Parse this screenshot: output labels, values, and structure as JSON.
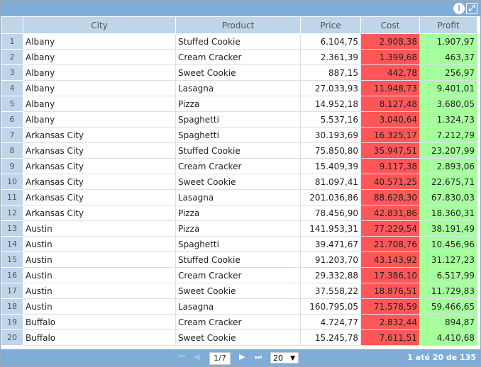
{
  "toolbar": {
    "info_icon": "i",
    "expand_icon": "⤢"
  },
  "columns": [
    "City",
    "Product",
    "Price",
    "Cost",
    "Profit"
  ],
  "rows": [
    [
      "1",
      "Albany",
      "Stuffed Cookie",
      "6.104,75",
      "2.908,38",
      "1.907,97"
    ],
    [
      "2",
      "Albany",
      "Cream Cracker",
      "2.361,39",
      "1.399,68",
      "463,37"
    ],
    [
      "3",
      "Albany",
      "Sweet Cookie",
      "887,15",
      "442,78",
      "256,97"
    ],
    [
      "4",
      "Albany",
      "Lasagna",
      "27.033,93",
      "11.948,73",
      "9.401,01"
    ],
    [
      "5",
      "Albany",
      "Pizza",
      "14.952,18",
      "8.127,48",
      "3.680,05"
    ],
    [
      "6",
      "Albany",
      "Spaghetti",
      "5.537,16",
      "3.040,64",
      "1.324,73"
    ],
    [
      "7",
      "Arkansas City",
      "Spaghetti",
      "30.193,69",
      "16.325,17",
      "7.212,79"
    ],
    [
      "8",
      "Arkansas City",
      "Stuffed Cookie",
      "75.850,80",
      "35.947,51",
      "23.207,99"
    ],
    [
      "9",
      "Arkansas City",
      "Cream Cracker",
      "15.409,39",
      "9.117,38",
      "2.893,06"
    ],
    [
      "10",
      "Arkansas City",
      "Sweet Cookie",
      "81.097,41",
      "40.571,25",
      "22.675,71"
    ],
    [
      "11",
      "Arkansas City",
      "Lasagna",
      "201.036,86",
      "88.628,30",
      "67.830,03"
    ],
    [
      "12",
      "Arkansas City",
      "Pizza",
      "78.456,90",
      "42.831,86",
      "18.360,31"
    ],
    [
      "13",
      "Austin",
      "Pizza",
      "141.953,31",
      "77.229,54",
      "38.191,49"
    ],
    [
      "14",
      "Austin",
      "Spaghetti",
      "39.471,67",
      "21.708,76",
      "10.456,96"
    ],
    [
      "15",
      "Austin",
      "Stuffed Cookie",
      "91.203,70",
      "43.143,92",
      "31.127,23"
    ],
    [
      "16",
      "Austin",
      "Cream Cracker",
      "29.332,88",
      "17.386,10",
      "6.517,99"
    ],
    [
      "17",
      "Austin",
      "Sweet Cookie",
      "37.558,22",
      "18.876,51",
      "11.729,83"
    ],
    [
      "18",
      "Austin",
      "Lasagna",
      "160.795,05",
      "71.578,59",
      "59.466,65"
    ],
    [
      "19",
      "Buffalo",
      "Cream Cracker",
      "4.724,77",
      "2.832,44",
      "894,87"
    ],
    [
      "20",
      "Buffalo",
      "Sweet Cookie",
      "15.245,78",
      "7.611,51",
      "4.410,68"
    ]
  ],
  "footer": {
    "page": "1/7",
    "page_size": "20",
    "summary": "1 até 20 de 135",
    "first": "⏮",
    "prev": "◀",
    "next": "▶",
    "last": "⏭",
    "dropdown": "▼"
  }
}
